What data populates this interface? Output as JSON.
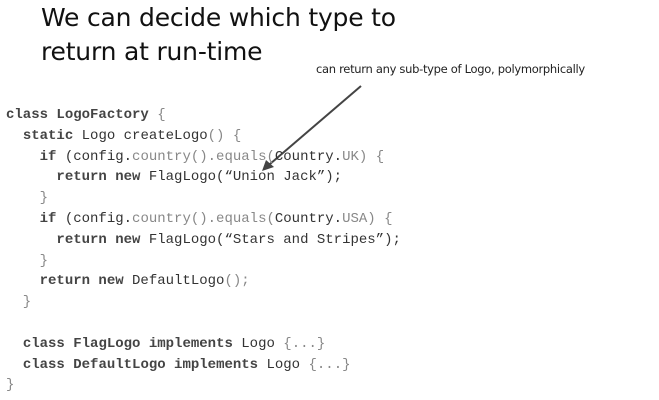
{
  "title": {
    "line1": "We can decide which type to",
    "line2": "return at run-time"
  },
  "annotation": "can return any sub-type of Logo, polymorphically",
  "code": {
    "lines": [
      [
        {
          "t": "class ",
          "c": "kw"
        },
        {
          "t": "LogoFactory",
          "c": "kw"
        },
        {
          "t": " {",
          "c": "lt"
        }
      ],
      [
        {
          "t": "  ",
          "c": "tx"
        },
        {
          "t": "static",
          "c": "kw"
        },
        {
          "t": " Logo createLogo",
          "c": "tx"
        },
        {
          "t": "() {",
          "c": "lt"
        }
      ],
      [
        {
          "t": "    ",
          "c": "tx"
        },
        {
          "t": "if",
          "c": "kw"
        },
        {
          "t": " (config.",
          "c": "tx"
        },
        {
          "t": "country().equals(",
          "c": "lt"
        },
        {
          "t": "Country.",
          "c": "tx"
        },
        {
          "t": "UK) {",
          "c": "lt"
        }
      ],
      [
        {
          "t": "      ",
          "c": "tx"
        },
        {
          "t": "return new",
          "c": "kw"
        },
        {
          "t": " FlagLogo(“Union Jack”);",
          "c": "tx"
        }
      ],
      [
        {
          "t": "    }",
          "c": "lt"
        }
      ],
      [
        {
          "t": "    ",
          "c": "tx"
        },
        {
          "t": "if",
          "c": "kw"
        },
        {
          "t": " (config.",
          "c": "tx"
        },
        {
          "t": "country().equals(",
          "c": "lt"
        },
        {
          "t": "Country.",
          "c": "tx"
        },
        {
          "t": "USA) {",
          "c": "lt"
        }
      ],
      [
        {
          "t": "      ",
          "c": "tx"
        },
        {
          "t": "return new",
          "c": "kw"
        },
        {
          "t": " FlagLogo(“Stars and Stripes”);",
          "c": "tx"
        }
      ],
      [
        {
          "t": "    }",
          "c": "lt"
        }
      ],
      [
        {
          "t": "    ",
          "c": "tx"
        },
        {
          "t": "return new",
          "c": "kw"
        },
        {
          "t": " DefaultLogo",
          "c": "tx"
        },
        {
          "t": "();",
          "c": "lt"
        }
      ],
      [
        {
          "t": "  }",
          "c": "lt"
        }
      ],
      [],
      [
        {
          "t": "  ",
          "c": "tx"
        },
        {
          "t": "class ",
          "c": "kw"
        },
        {
          "t": "FlagLogo",
          "c": "kw"
        },
        {
          "t": " implements",
          "c": "kw"
        },
        {
          "t": " Logo ",
          "c": "tx"
        },
        {
          "t": "{...}",
          "c": "lt"
        }
      ],
      [
        {
          "t": "  ",
          "c": "tx"
        },
        {
          "t": "class ",
          "c": "kw"
        },
        {
          "t": "DefaultLogo",
          "c": "kw"
        },
        {
          "t": " implements",
          "c": "kw"
        },
        {
          "t": " Logo ",
          "c": "tx"
        },
        {
          "t": "{...}",
          "c": "lt"
        }
      ],
      [
        {
          "t": "}",
          "c": "lt"
        }
      ]
    ]
  }
}
